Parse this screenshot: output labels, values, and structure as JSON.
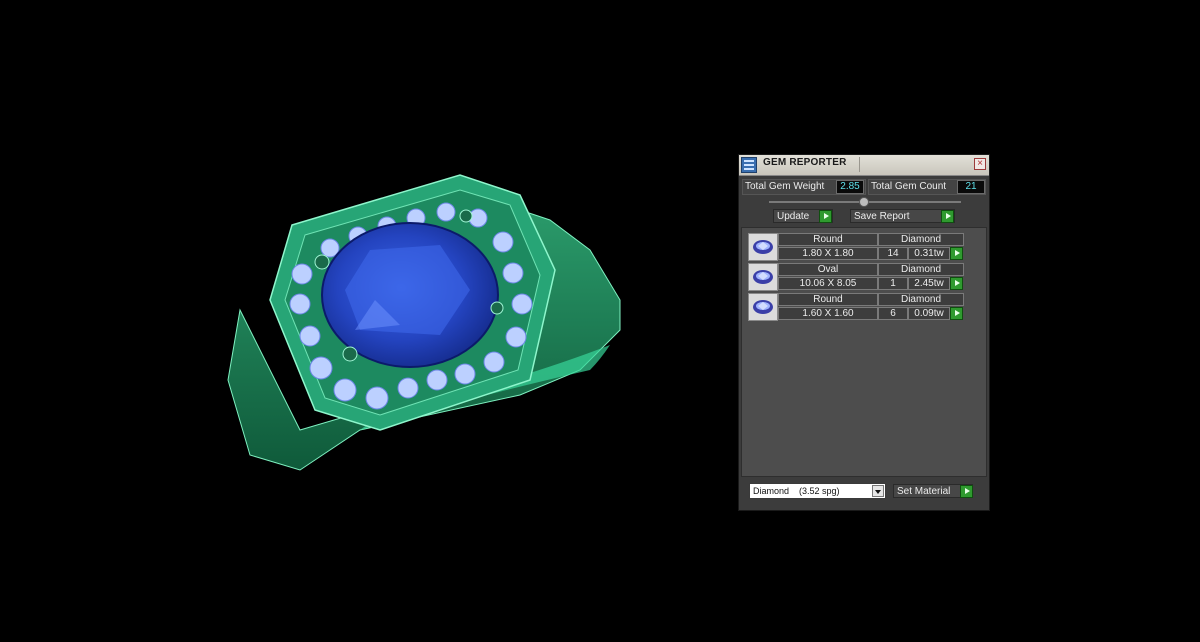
{
  "panel": {
    "title": "GEM REPORTER",
    "total_weight_label": "Total Gem Weight",
    "total_weight_value": "2.85",
    "total_count_label": "Total Gem Count",
    "total_count_value": "21",
    "update_label": "Update",
    "save_report_label": "Save Report",
    "gems": [
      {
        "shape": "Round",
        "size": "1.80 X 1.80",
        "material": "Diamond",
        "count": "14",
        "weight": "0.31tw"
      },
      {
        "shape": "Oval",
        "size": "10.06 X 8.05",
        "material": "Diamond",
        "count": "1",
        "weight": "2.45tw"
      },
      {
        "shape": "Round",
        "size": "1.60 X 1.60",
        "material": "Diamond",
        "count": "6",
        "weight": "0.09tw"
      }
    ],
    "material_select": {
      "name": "Diamond",
      "spg": "(3.52 spg)"
    },
    "set_material_label": "Set Material",
    "icons": {
      "title": "gem-reporter-icon",
      "close": "close-icon",
      "go": "play-arrow-icon",
      "gem": "gem-thumbnail-icon"
    }
  },
  "colors": {
    "metal": "#2fb07a",
    "center_stone": "#1f3fb5",
    "accent_value": "#5fe0ea",
    "go_button": "#2f9a2f"
  }
}
